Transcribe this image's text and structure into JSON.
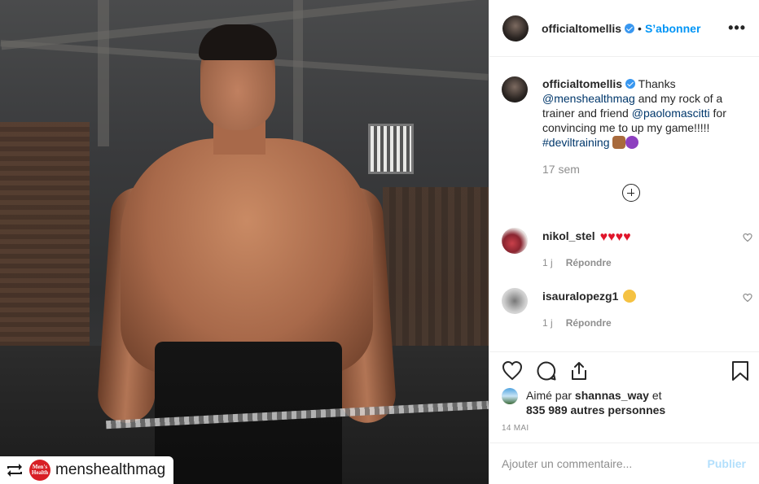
{
  "post": {
    "repost_user": "menshealthmag",
    "repost_logo_text": "Men's Health"
  },
  "header": {
    "username": "officialtomellis",
    "separator": "•",
    "follow_label": "S’abonner",
    "more_label": "•••"
  },
  "caption": {
    "username": "officialtomellis",
    "text_1": "Thanks",
    "mention_1": "@menshealthmag",
    "text_2": "and my rock of a trainer and friend",
    "mention_2": "@paolomascitti",
    "text_3": "for convincing me to up my game!!!!!",
    "hashtag": "#deviltraining",
    "time": "17 sem"
  },
  "comments": [
    {
      "username": "nikol_stel",
      "hearts": [
        "♥",
        "♥",
        "♥",
        "♥"
      ],
      "age": "1 j",
      "reply_label": "Répondre"
    },
    {
      "username": "isauralopezg1",
      "age": "1 j",
      "reply_label": "Répondre"
    }
  ],
  "likes": {
    "prefix": "Aimé par",
    "user": "shannas_way",
    "joiner": "et",
    "count_text": "835 989 autres personnes"
  },
  "date": "14 MAI",
  "composer": {
    "placeholder": "Ajouter un commentaire...",
    "publish_label": "Publier"
  },
  "colors": {
    "link": "#00376b",
    "follow": "#0095f6",
    "publish_disabled": "#b2dffc",
    "heart_red": "#e0162b",
    "verified": "#3897f0"
  },
  "icons": [
    "repost-icon",
    "verified-icon",
    "more-icon",
    "add-circle-icon",
    "like-icon",
    "comment-icon",
    "share-icon",
    "save-icon",
    "comment-like-icon"
  ]
}
